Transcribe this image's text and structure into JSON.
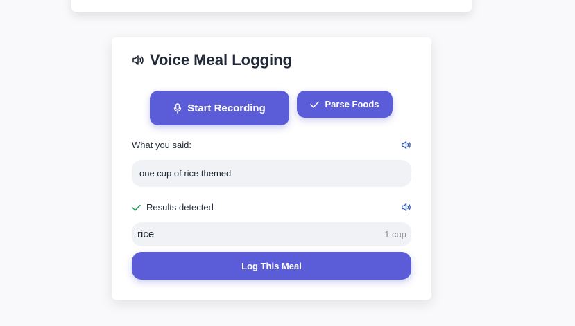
{
  "page": {
    "accent_color": "#5a5cd8",
    "success_color": "#22a35a"
  },
  "card": {
    "title": "Voice Meal Logging",
    "title_icon": "speaker-icon"
  },
  "buttons": {
    "record_label": "Start Recording",
    "record_icon": "microphone-icon",
    "parse_label": "Parse Foods",
    "parse_icon": "check-icon",
    "log_label": "Log This Meal"
  },
  "transcript": {
    "label": "What you said:",
    "value": "one cup of rice themed",
    "speak_icon": "speaker-icon"
  },
  "results": {
    "label": "Results detected",
    "status_icon": "check-icon",
    "speak_icon": "speaker-icon",
    "items": [
      {
        "name": "rice",
        "quantity": "1 cup"
      }
    ]
  }
}
